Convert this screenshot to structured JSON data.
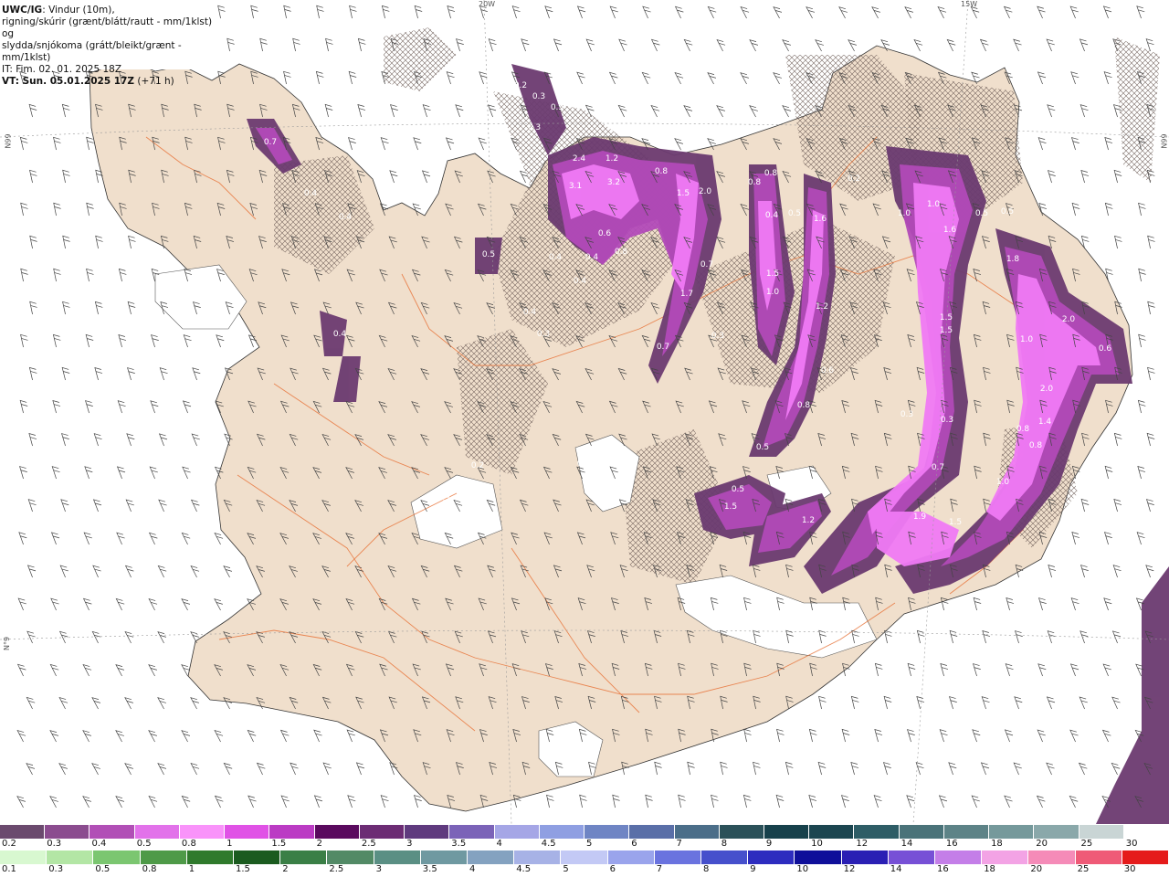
{
  "header": {
    "model": "UWC/IG",
    "title_rest": ": Vindur (10m),",
    "line2": "rigning/skúrir (grænt/blátt/rautt - mm/1klst) og",
    "line3": "slydda/snjókoma (grátt/bleikt/grænt - mm/1klst)",
    "it": "IT: Fim. 02. 01. 2025 18Z",
    "vt_bold": "VT: Sun. 05.01.2025 17Z",
    "vt_extra": " (+71 h)"
  },
  "grid_labels": [
    "20W",
    "15W",
    "66N",
    "66N",
    "N°9"
  ],
  "precip_labels": [
    "0.2",
    "0.3",
    "0.5",
    "0.3",
    "0.7",
    "0.4",
    "0.4",
    "2.4",
    "1.2",
    "3.1",
    "3.2",
    "0.8",
    "1.5",
    "2.0",
    "0.8",
    "0.2",
    "0.8",
    "1.0",
    "1.0",
    "1.6",
    "0.5",
    "0.5",
    "0.6",
    "0.4",
    "0.4",
    "0.8",
    "0.4",
    "0.5",
    "1.5",
    "1.7",
    "0.7",
    "0.4",
    "0.7",
    "0.3",
    "1.6",
    "1.0",
    "1.2",
    "0.4",
    "0.5",
    "1.8",
    "1.5",
    "1.5",
    "1.0",
    "2.0",
    "0.6",
    "0.3",
    "0.3",
    "1.4",
    "2.0",
    "0.8",
    "0.8",
    "0.6",
    "0.4",
    "0.3",
    "0.8",
    "0.5",
    "0.7",
    "0.5",
    "1.5",
    "1.2",
    "0.3",
    "0.2",
    "1.0",
    "1.9",
    "1.5",
    "0.2"
  ],
  "legend_snow": {
    "labels": [
      "0.2",
      "0.3",
      "0.4",
      "0.5",
      "0.8",
      "1",
      "1.5",
      "2",
      "2.5",
      "3",
      "3.5",
      "4",
      "4.5",
      "5",
      "6",
      "7",
      "8",
      "9",
      "10",
      "12",
      "14",
      "16",
      "18",
      "20",
      "25",
      "30"
    ],
    "colors": [
      "#6b4a6e",
      "#8b4c8f",
      "#b14fb6",
      "#e272ea",
      "#f993fa",
      "#e052e6",
      "#bb3bc4",
      "#5a0a5e",
      "#6c2c74",
      "#5f3a7e",
      "#7b63b8",
      "#a5a6e6",
      "#8f9fe2",
      "#6f85c4",
      "#5a6fa8",
      "#4b6e89",
      "#2b5159",
      "#17414b",
      "#1c4650",
      "#2e5d66",
      "#4a7379",
      "#5d8387",
      "#75999b",
      "#8aa8aa",
      "#c9d5d5",
      "#ffffff"
    ]
  },
  "legend_rain": {
    "labels": [
      "0.1",
      "0.3",
      "0.5",
      "0.8",
      "1",
      "1.5",
      "2",
      "2.5",
      "3",
      "3.5",
      "4",
      "4.5",
      "5",
      "6",
      "7",
      "8",
      "9",
      "10",
      "12",
      "14",
      "16",
      "18",
      "20",
      "25",
      "30"
    ],
    "colors": [
      "#d8f8d0",
      "#b3e6a5",
      "#7bc670",
      "#4e9a48",
      "#2f7a2c",
      "#1b5b1f",
      "#3a7f46",
      "#528a66",
      "#5a8f84",
      "#6f99a1",
      "#84a2c0",
      "#a7b2e6",
      "#c3c9f5",
      "#9aa4ec",
      "#6a73df",
      "#4650cc",
      "#2d2cbf",
      "#0f0f9a",
      "#2a1fb4",
      "#7750d6",
      "#c47ee8",
      "#f3a3e5",
      "#f58bb8",
      "#ef5a77",
      "#e51b1b"
    ]
  },
  "colors": {
    "land": "#f0dfcc",
    "ice": "#ffffff",
    "roads": "#e8763c",
    "snow_light": "#6b3a70",
    "snow_mid": "#b24ab8",
    "snow_heavy": "#f07af5"
  }
}
